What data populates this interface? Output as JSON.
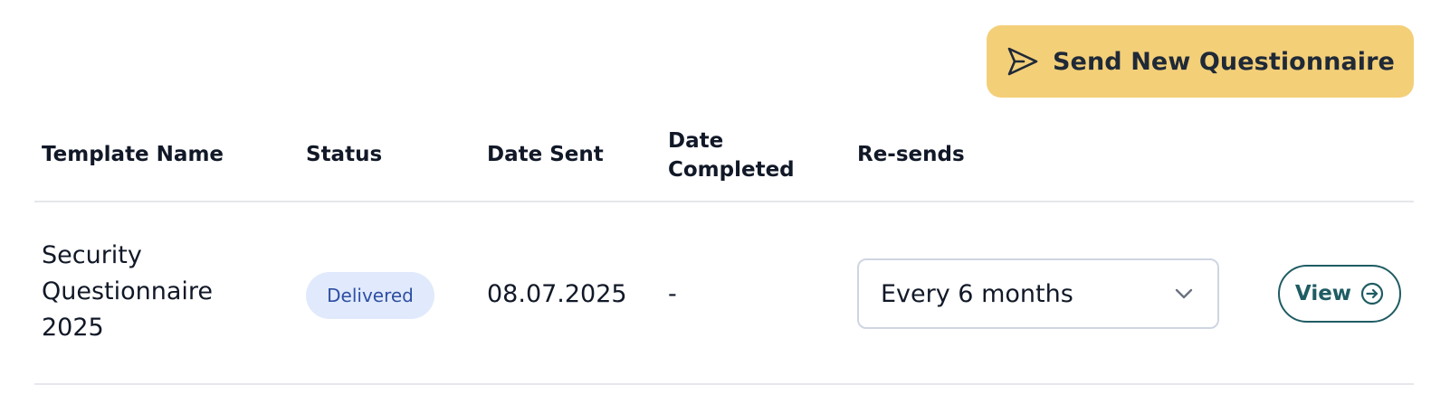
{
  "actions": {
    "send_label": "Send New Questionnaire",
    "send_icon": "paper-plane-icon"
  },
  "table": {
    "columns": {
      "template_name": "Template Name",
      "status": "Status",
      "date_sent": "Date Sent",
      "date_completed_line1": "Date",
      "date_completed_line2": "Completed",
      "resends": "Re-sends"
    },
    "rows": [
      {
        "template_name": "Security Questionnaire 2025",
        "status": "Delivered",
        "date_sent": "08.07.2025",
        "date_completed": "-",
        "resends": "Every 6 months",
        "view_label": "View",
        "view_icon": "arrow-circle-right-icon",
        "resends_icon": "chevron-down-icon"
      }
    ]
  },
  "colors": {
    "send_button_bg": "#f3cf78",
    "status_badge_bg": "#e0eafc",
    "status_badge_text": "#2f4fa3",
    "view_button": "#1f5c63"
  }
}
